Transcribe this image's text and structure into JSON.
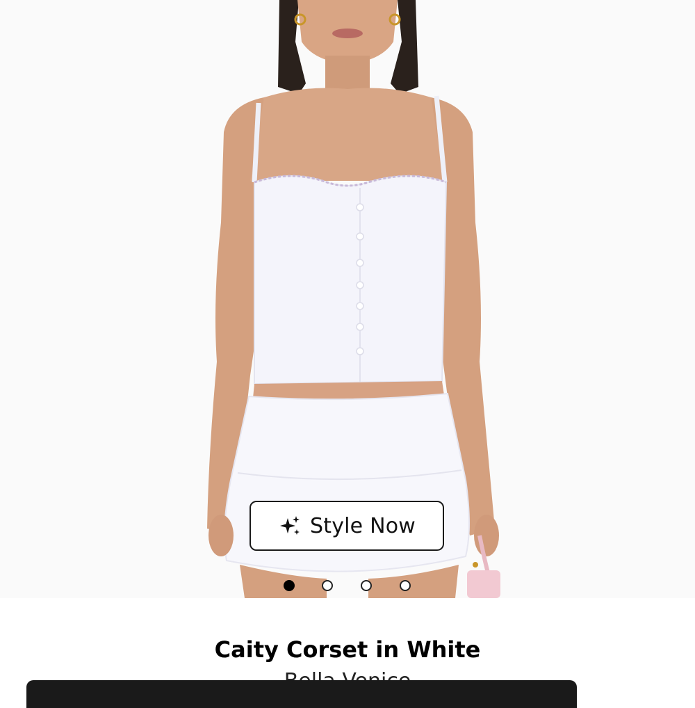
{
  "carousel": {
    "style_button_label": "Style Now",
    "style_button_icon": "sparkles-icon",
    "dots_count": 4,
    "active_index": 0
  },
  "product": {
    "title": "Caity Corset in White",
    "brand": "Bella Venice"
  },
  "colors": {
    "accent": "#000000",
    "bottom_bar": "#1a1a1a"
  }
}
